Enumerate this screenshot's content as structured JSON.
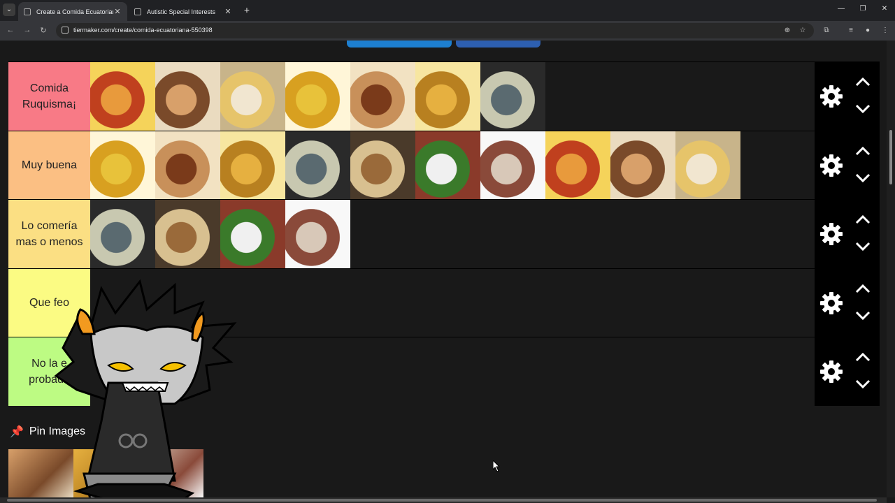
{
  "browser": {
    "tabs": [
      {
        "title": "Create a Comida Ecuatoriana Ti",
        "active": true
      },
      {
        "title": "Autistic Special Interests",
        "active": false
      }
    ],
    "url": "tiermaker.com/create/comida-ecuatoriana-550398"
  },
  "tiers": [
    {
      "label": "Comida Ruquisma¡",
      "color": "#f87a86",
      "items": 7
    },
    {
      "label": "Muy buena",
      "color": "#fbbf83",
      "items": 10
    },
    {
      "label": "Lo comería mas o menos",
      "color": "#fbdf83",
      "items": 4
    },
    {
      "label": "Que feo",
      "color": "#fbfb83",
      "items": 0
    },
    {
      "label": "No la e probado",
      "color": "#bdfb83",
      "items": 0
    }
  ],
  "pin_images": {
    "label": "Pin Images",
    "thumbnails": 3
  },
  "icons": {
    "settings": "gear-icon",
    "move_up": "chevron-up-icon",
    "move_down": "chevron-down-icon",
    "pin": "pushpin-icon"
  },
  "colors": {
    "page_bg": "#191919",
    "control_bg": "#000000",
    "top_button_blue": "#1d7fd0",
    "top_button_indigo": "#2d5fb0"
  }
}
